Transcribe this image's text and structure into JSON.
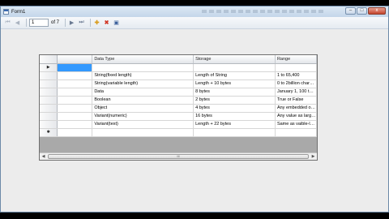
{
  "window": {
    "title": "Form1",
    "buttons": {
      "minimize": "–",
      "maximize": "□",
      "close": "x"
    }
  },
  "navigator": {
    "position": "1",
    "count_label": "of 7",
    "icons": [
      "move-first-icon",
      "move-previous-icon",
      "move-next-icon",
      "move-last-icon",
      "add-new-icon",
      "delete-icon",
      "save-icon"
    ]
  },
  "grid": {
    "columns": [
      "Data Type",
      "Storage",
      "Range"
    ],
    "rows": [
      {
        "indicator": "▶",
        "type": "",
        "storage": "",
        "range": "",
        "selected": true
      },
      {
        "indicator": "",
        "type": "String(fixed length)",
        "storage": "Length of String",
        "range": "1 to 65,400"
      },
      {
        "indicator": "",
        "type": "String(variable length)",
        "storage": "Length + 10 bytes",
        "range": "0 to 2billion char…"
      },
      {
        "indicator": "",
        "type": "Data",
        "storage": "8 bytes",
        "range": "January 1, 100 t…"
      },
      {
        "indicator": "",
        "type": "Boolean",
        "storage": "2 bytes",
        "range": "True or False"
      },
      {
        "indicator": "",
        "type": "Object",
        "storage": "4 bytes",
        "range": "Any embedded o…"
      },
      {
        "indicator": "",
        "type": "Variant(numeric)",
        "storage": "16 bytes",
        "range": "Any value as larg…"
      },
      {
        "indicator": "",
        "type": "Variant(text)",
        "storage": "Length + 22 bytes",
        "range": "Same as vaible-l…"
      },
      {
        "indicator": "✱",
        "type": "",
        "storage": "",
        "range": ""
      }
    ],
    "scroll": {
      "left": "◀",
      "right": "▶",
      "thumb": "III"
    }
  }
}
